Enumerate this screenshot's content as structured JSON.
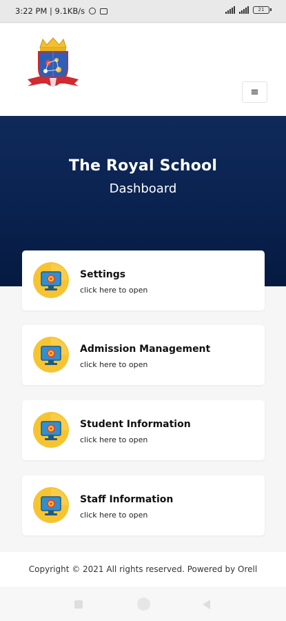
{
  "status_bar": {
    "time_text": "3:22 PM | 9.1KB/s",
    "battery_level": "21"
  },
  "header": {
    "logo_icon": "school-crest-icon",
    "menu_icon": "hamburger-menu-icon",
    "menu_glyph": "≡"
  },
  "hero": {
    "title": "The Royal School",
    "subtitle": "Dashboard"
  },
  "cards": [
    {
      "title": "Settings",
      "subtitle": "click here to open",
      "icon": "monitor-gear-icon"
    },
    {
      "title": "Admission Management",
      "subtitle": "click here to open",
      "icon": "monitor-gear-icon"
    },
    {
      "title": "Student Information",
      "subtitle": "click here to open",
      "icon": "monitor-gear-icon"
    },
    {
      "title": "Staff Information",
      "subtitle": "click here to open",
      "icon": "monitor-gear-icon"
    }
  ],
  "footer": {
    "text": "Copyright © 2021 All rights reserved. Powered by Orell"
  },
  "colors": {
    "hero_top": "#0f2a59",
    "hero_bottom": "#061a40",
    "icon_yellow": "#f7c431",
    "icon_screen": "#2f8fd0"
  }
}
